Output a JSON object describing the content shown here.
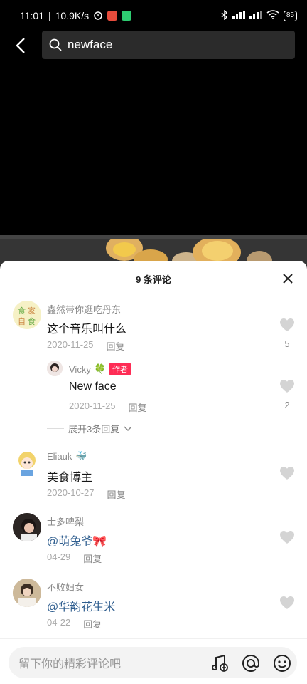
{
  "status_bar": {
    "time": "11:01",
    "speed": "10.9K/s",
    "battery": "85",
    "colors": {
      "app1": "#e74c3c",
      "app2": "#2ecc71"
    }
  },
  "search": {
    "query": "newface",
    "icon": "search-icon"
  },
  "comments_sheet": {
    "title": "9 条评论",
    "close_icon": "close-icon",
    "comments": [
      {
        "user": "鑫然带你逛吃丹东",
        "text": "这个音乐叫什么",
        "date": "2020-11-25",
        "reply": "回复",
        "likes": "5"
      },
      {
        "user": "Vicky",
        "emoji": "🍀",
        "tag": "作者",
        "text": "New face",
        "date": "2020-11-25",
        "reply": "回复",
        "likes": "2"
      },
      {
        "user": "Eliauk",
        "emoji": "🐳",
        "text": "美食博主",
        "date": "2020-10-27",
        "reply": "回复",
        "likes": ""
      },
      {
        "user": "士多啤梨",
        "text": "@萌兔爷🎀",
        "date": "04-29",
        "reply": "回复",
        "likes": ""
      },
      {
        "user": "不败妇女",
        "text": "@华韵花生米",
        "date": "04-22",
        "reply": "回复",
        "likes": ""
      }
    ],
    "expand_replies": "展开3条回复"
  },
  "input": {
    "placeholder": "留下你的精彩评论吧",
    "icons": [
      "music-add-icon",
      "at-icon",
      "emoji-icon"
    ]
  }
}
